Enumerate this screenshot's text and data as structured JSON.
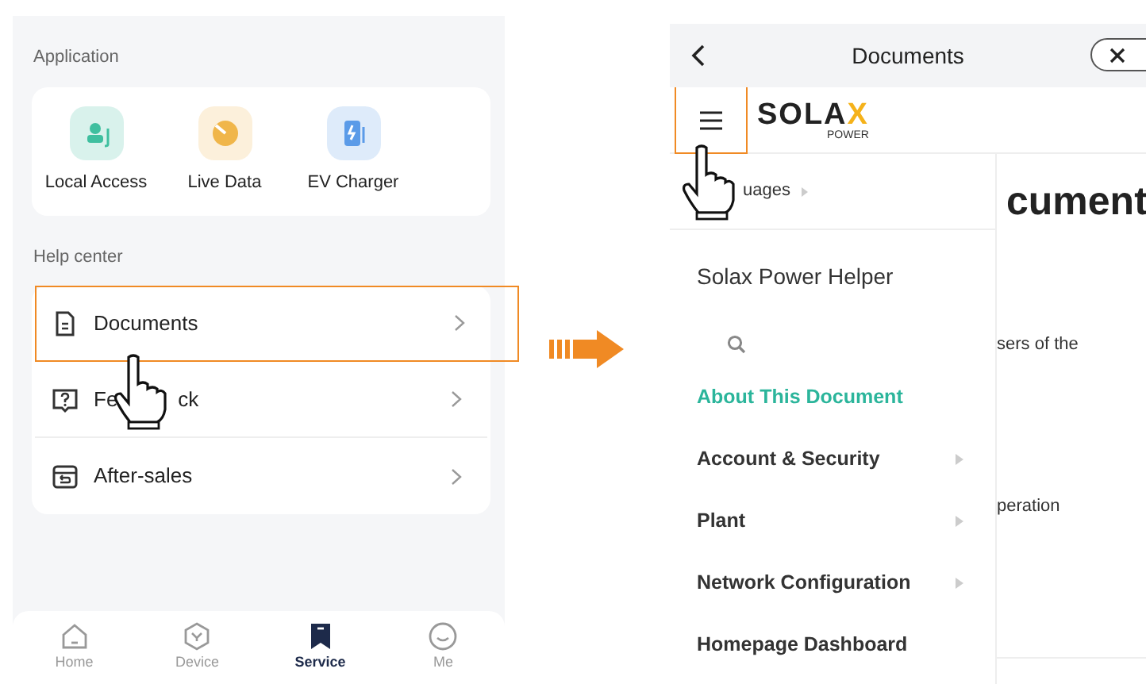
{
  "service_screen": {
    "application": {
      "heading": "Application",
      "items": [
        {
          "label": "Local Access",
          "color": "#3fbf9f"
        },
        {
          "label": "Live Data",
          "color": "#f0b64a"
        },
        {
          "label": "EV Charger",
          "color": "#5b9be8"
        }
      ]
    },
    "help_center": {
      "heading": "Help center",
      "rows": [
        {
          "label_parts": [
            "Documents"
          ],
          "selected": true
        },
        {
          "label_parts": [
            "Fe",
            "ck"
          ],
          "selected": false
        },
        {
          "label_parts": [
            "After-sales"
          ],
          "selected": false
        }
      ]
    },
    "tab_bar": [
      {
        "label": "Home",
        "selected": false
      },
      {
        "label": "Device",
        "selected": false
      },
      {
        "label": "Service",
        "selected": true
      },
      {
        "label": "Me",
        "selected": false
      }
    ]
  },
  "documents_screen": {
    "title": "Documents",
    "logo": {
      "text": "SOLA",
      "accent": "X",
      "sub": "POWER"
    },
    "drawer": {
      "languages": "uages",
      "helper": "Solax Power Helper",
      "items": [
        {
          "label": "About This Document",
          "selected": true,
          "has_submenu": false
        },
        {
          "label": "Account & Security",
          "selected": false,
          "has_submenu": true
        },
        {
          "label": "Plant",
          "selected": false,
          "has_submenu": true
        },
        {
          "label": "Network Configuration",
          "selected": false,
          "has_submenu": true
        },
        {
          "label": "Homepage Dashboard",
          "selected": false,
          "has_submenu": false
        }
      ]
    },
    "document_peek": {
      "heading": "cument",
      "lines": [
        "sers of the",
        "peration"
      ]
    }
  }
}
